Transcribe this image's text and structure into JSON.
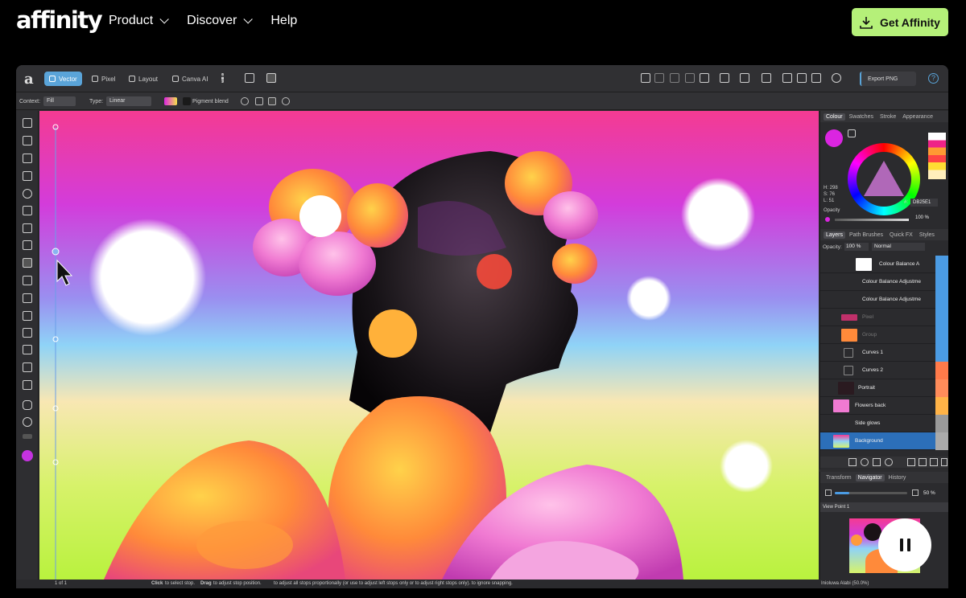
{
  "site": {
    "logo": "affinity",
    "nav": [
      {
        "label": "Product",
        "has_dropdown": true
      },
      {
        "label": "Discover",
        "has_dropdown": true
      },
      {
        "label": "Help",
        "has_dropdown": false
      }
    ],
    "cta_label": "Get Affinity",
    "cta_color": "#b5f079"
  },
  "app": {
    "personas": [
      {
        "label": "Vector",
        "active": true
      },
      {
        "label": "Pixel",
        "active": false
      },
      {
        "label": "Layout",
        "active": false
      },
      {
        "label": "Canva AI",
        "active": false
      }
    ],
    "export_label": "Export PNG",
    "context": {
      "context_label": "Context:",
      "context_value": "Fill",
      "type_label": "Type:",
      "type_value": "Linear",
      "pigment_label": "Pigment blend"
    },
    "colour_panel": {
      "tabs": [
        "Colour",
        "Swatches",
        "Stroke",
        "Appearance"
      ],
      "active_tab": "Colour",
      "h": "H: 298",
      "s": "S: 76",
      "l": "L: 51",
      "hex_label": "#:",
      "hex": "DB25E1",
      "opacity_label": "Opacity",
      "opacity_value": "100 %",
      "current_color": "#db25e1"
    },
    "layers_panel": {
      "tabs": [
        "Layers",
        "Path Brushes",
        "Quick FX",
        "Styles"
      ],
      "active_tab": "Layers",
      "opacity_label": "Opacity:",
      "opacity_value": "100 %",
      "blend_mode": "Normal",
      "layers": [
        {
          "name": "Colour Balance A",
          "selected": false
        },
        {
          "name": "Colour Balance Adjustme",
          "selected": false
        },
        {
          "name": "Colour Balance Adjustme",
          "selected": false
        },
        {
          "name": "Pixel",
          "selected": false
        },
        {
          "name": "Group",
          "selected": false
        },
        {
          "name": "Curves 1",
          "selected": false
        },
        {
          "name": "Curves 2",
          "selected": false
        },
        {
          "name": "Portrait",
          "selected": false
        },
        {
          "name": "Flowers back",
          "selected": false
        },
        {
          "name": "Side glows",
          "selected": false
        },
        {
          "name": "Background",
          "selected": true
        }
      ]
    },
    "navigator_panel": {
      "tabs": [
        "Transform",
        "Navigator",
        "History"
      ],
      "active_tab": "Navigator",
      "zoom": "50 %",
      "zoom_fraction": 0.2,
      "view_point": "View Point 1",
      "caption": "Inioluwa Alabi (50.0%)"
    },
    "status": {
      "page": "1 of 1",
      "hint_click": "Click",
      "hint_click_text": "to select stop.",
      "hint_drag": "Drag",
      "hint_drag_text": "to adjust stop position.",
      "hint_rest": "to adjust all stops proportionally (or use   to adjust left stops only or   to adjust right stops only).   to ignore snapping."
    }
  }
}
